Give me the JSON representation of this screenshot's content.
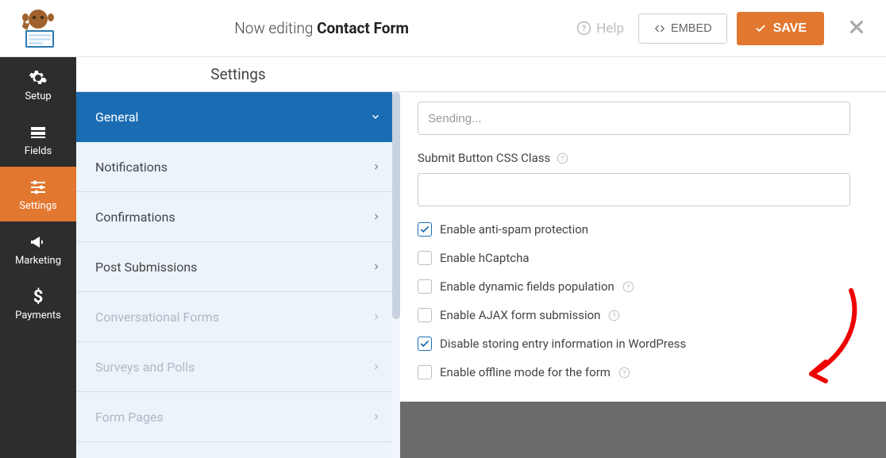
{
  "top": {
    "editing_prefix": "Now editing ",
    "form_name": "Contact Form",
    "help": "Help",
    "embed": "EMBED",
    "save": "SAVE"
  },
  "sidebar": {
    "items": [
      {
        "label": "Setup"
      },
      {
        "label": "Fields"
      },
      {
        "label": "Settings"
      },
      {
        "label": "Marketing"
      },
      {
        "label": "Payments"
      }
    ]
  },
  "settings": {
    "header": "Settings",
    "menu": [
      {
        "label": "General",
        "active": true
      },
      {
        "label": "Notifications"
      },
      {
        "label": "Confirmations"
      },
      {
        "label": "Post Submissions"
      },
      {
        "label": "Conversational Forms",
        "disabled": true
      },
      {
        "label": "Surveys and Polls",
        "disabled": true
      },
      {
        "label": "Form Pages",
        "disabled": true
      }
    ]
  },
  "panel": {
    "sending_value": "Sending...",
    "css_label": "Submit Button CSS Class",
    "css_value": "",
    "checks": [
      {
        "label": "Enable anti-spam protection",
        "checked": true,
        "help": false
      },
      {
        "label": "Enable hCaptcha",
        "checked": false,
        "help": false
      },
      {
        "label": "Enable dynamic fields population",
        "checked": false,
        "help": true
      },
      {
        "label": "Enable AJAX form submission",
        "checked": false,
        "help": true
      },
      {
        "label": "Disable storing entry information in WordPress",
        "checked": true,
        "help": false
      },
      {
        "label": "Enable offline mode for the form",
        "checked": false,
        "help": true
      }
    ]
  }
}
